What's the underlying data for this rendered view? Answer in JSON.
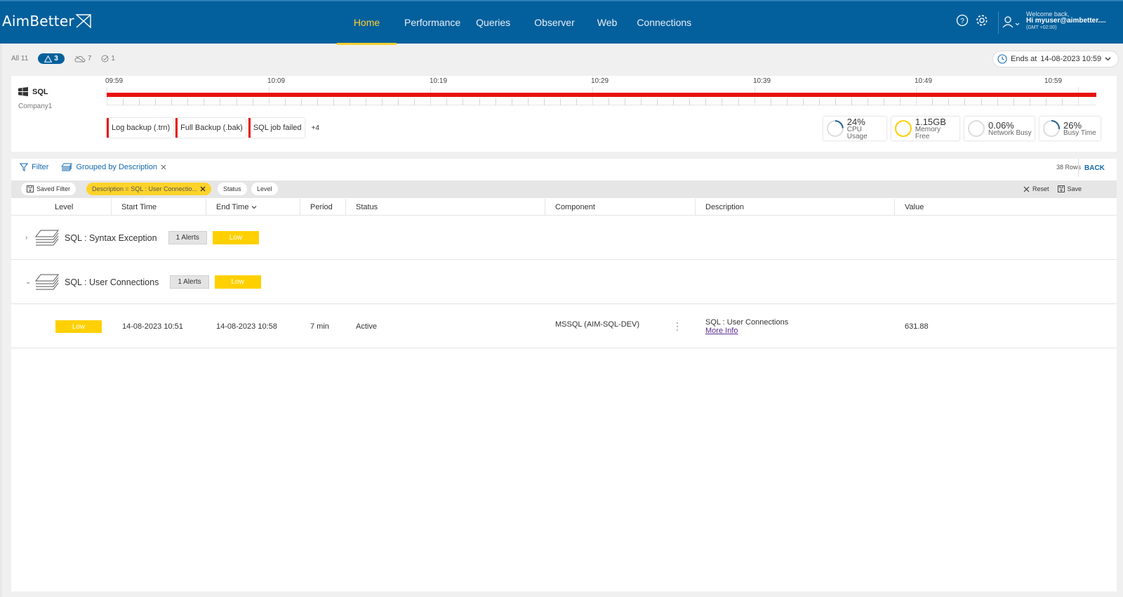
{
  "app": {
    "logo_text": "AimBetter"
  },
  "nav": [
    {
      "label": "Home",
      "active": true
    },
    {
      "label": "Performance"
    },
    {
      "label": "Queries"
    },
    {
      "label": "Observer"
    },
    {
      "label": "Web"
    },
    {
      "label": "Connections"
    }
  ],
  "user": {
    "welcome": "Welcome back,",
    "name": "Hi myuser@aimbetter....",
    "timezone": "(GMT +02:00)"
  },
  "status_filters": {
    "all_label": "All 11",
    "alerts_count": "3",
    "cloud_count": "7",
    "check_count": "1"
  },
  "ends_at": {
    "label": "Ends at",
    "value": "14-08-2023 10:59"
  },
  "server": {
    "name": "SQL",
    "company": "Company1"
  },
  "timeline": {
    "labels": [
      "09:59",
      "10:09",
      "10:19",
      "10:29",
      "10:39",
      "10:49",
      "10:59"
    ]
  },
  "alert_chips": [
    "Log backup (.trn)",
    "Full Backup (.bak)",
    "SQL job failed"
  ],
  "alert_more": "+4",
  "metrics": [
    {
      "value": "24%",
      "label": "CPU Usage",
      "level": 0.24,
      "color": "#1d5c91"
    },
    {
      "value": "1.15GB",
      "label": "Memory Free",
      "level": 1.0,
      "color": "#ffd000"
    },
    {
      "value": "0.06%",
      "label": "Network Busy",
      "level": 0.0006,
      "color": "#1d5c91"
    },
    {
      "value": "26%",
      "label": "Busy Time",
      "level": 0.26,
      "color": "#1d5c91"
    }
  ],
  "filter_bar": {
    "filter_label": "Filter",
    "grouped_label": "Grouped by Description",
    "rows": "38 Rows",
    "back": "BACK"
  },
  "chips": {
    "saved_filter": "Saved Filter",
    "description_filter": "Description = SQL : User Connectio...",
    "status": "Status",
    "level": "Level",
    "reset": "Reset",
    "save": "Save"
  },
  "columns": [
    "Level",
    "Start Time",
    "End Time",
    "Period",
    "Status",
    "Component",
    "Description",
    "Value"
  ],
  "groups": [
    {
      "title": "SQL : Syntax Exception",
      "alerts": "1 Alerts",
      "level": "Low",
      "expanded": false
    },
    {
      "title": "SQL : User Connections",
      "alerts": "1 Alerts",
      "level": "Low",
      "expanded": true
    }
  ],
  "row": {
    "level": "Low",
    "start": "14-08-2023 10:51",
    "end": "14-08-2023 10:58",
    "period": "7 min",
    "status": "Active",
    "component": "MSSQL (AIM-SQL-DEV)",
    "description": "SQL : User Connections",
    "more_info": "More Info",
    "value": "631.88"
  },
  "colors": {
    "brand": "#04609c",
    "accent": "#ffcf2e",
    "alert_red": "#e8130e",
    "low_yellow": "#ffd000"
  }
}
